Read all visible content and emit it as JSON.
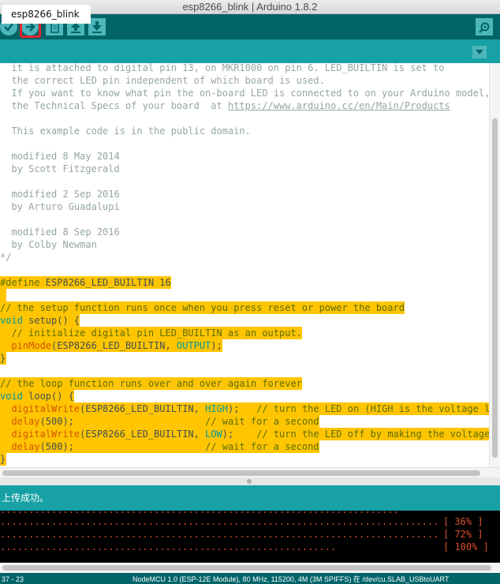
{
  "window": {
    "title": "esp8266_blink | Arduino 1.8.2"
  },
  "toolbar": {
    "buttons": [
      {
        "name": "verify",
        "icon": "check-icon"
      },
      {
        "name": "upload",
        "icon": "arrow-right-icon",
        "highlighted": true
      },
      {
        "name": "new",
        "icon": "page-icon"
      },
      {
        "name": "open",
        "icon": "arrow-up-icon"
      },
      {
        "name": "save",
        "icon": "arrow-down-icon"
      },
      {
        "name": "serial-monitor",
        "icon": "magnifier-icon"
      }
    ],
    "highlight_color": "#e4262d"
  },
  "tab": {
    "label": "esp8266_blink"
  },
  "code": {
    "lines": [
      {
        "text": "  it is attached to digital pin 13, on MKR1000 on pin 6. LED_BUILTIN is set to",
        "kind": "comment"
      },
      {
        "text": "  the correct LED pin independent of which board is used.",
        "kind": "comment"
      },
      {
        "text": "  If you want to know what pin the on-board LED is connected to on your Arduino model, che",
        "kind": "comment"
      },
      {
        "pre": "  the Technical Specs of your board  at ",
        "link": "https://www.arduino.cc/en/Main/Products",
        "kind": "comment-link"
      },
      {
        "text": "",
        "kind": "blank"
      },
      {
        "text": "  This example code is in the public domain.",
        "kind": "comment"
      },
      {
        "text": "",
        "kind": "blank"
      },
      {
        "text": "  modified 8 May 2014",
        "kind": "comment"
      },
      {
        "text": "  by Scott Fitzgerald",
        "kind": "comment"
      },
      {
        "text": "",
        "kind": "blank"
      },
      {
        "text": "  modified 2 Sep 2016",
        "kind": "comment"
      },
      {
        "text": "  by Arturo Guadalupi",
        "kind": "comment"
      },
      {
        "text": "",
        "kind": "blank"
      },
      {
        "text": "  modified 8 Sep 2016",
        "kind": "comment"
      },
      {
        "text": "  by Colby Newman",
        "kind": "comment"
      },
      {
        "text": "*/",
        "kind": "comment"
      },
      {
        "text": "",
        "kind": "blank"
      },
      {
        "directive": "#define",
        "rest": " ESP8266_LED_BUILTIN 16",
        "kind": "define"
      },
      {
        "text": "",
        "kind": "blank-hl"
      },
      {
        "text": "// the setup function runs once when you press reset or power the board",
        "kind": "comment-hl"
      },
      {
        "type": "void",
        "rest": " setup() {",
        "kind": "func-hl"
      },
      {
        "text": "  // initialize digital pin LED_BUILTIN as an output.",
        "kind": "comment-hl"
      },
      {
        "indent": "  ",
        "fn": "pinMode",
        "open": "(ESP8266_LED_BUILTIN, ",
        "arg": "OUTPUT",
        "close": ");",
        "kind": "call-hl"
      },
      {
        "text": "}",
        "kind": "code-hl"
      },
      {
        "text": "",
        "kind": "blank"
      },
      {
        "text": "// the loop function runs over and over again forever",
        "kind": "comment-hl"
      },
      {
        "type": "void",
        "rest": " loop() {",
        "kind": "func-hl"
      },
      {
        "indent": "  ",
        "fn": "digitalWrite",
        "open": "(ESP8266_LED_BUILTIN, ",
        "arg": "HIGH",
        "close": ");",
        "comment": "   // turn the LED on (HIGH is the voltage level)",
        "kind": "call-hl"
      },
      {
        "indent": "  ",
        "fn": "delay",
        "open": "(500);",
        "arg": "",
        "close": "",
        "comment": "                       // wait for a second",
        "kind": "call-hl"
      },
      {
        "indent": "  ",
        "fn": "digitalWrite",
        "open": "(ESP8266_LED_BUILTIN, ",
        "arg": "LOW",
        "close": ");",
        "comment": "    // turn the LED off by making the voltage LOW",
        "kind": "call-hl"
      },
      {
        "indent": "  ",
        "fn": "delay",
        "open": "(500);",
        "arg": "",
        "close": "",
        "comment": "                       // wait for a second",
        "kind": "call-hl"
      },
      {
        "text": "}",
        "kind": "code-hl"
      }
    ]
  },
  "status": {
    "message": "上传成功。"
  },
  "console": {
    "lines": [
      {
        "dots": ".............................................................................",
        "pct": "[ 36% ]"
      },
      {
        "dots": ".............................................................................",
        "pct": "[ 72% ]"
      },
      {
        "dots": "...........................................................",
        "pct": "[ 100% ]"
      }
    ]
  },
  "footer": {
    "line_position": "37 - 23",
    "board_info": "NodeMCU 1.0 (ESP-12E Module), 80 MHz, 115200, 4M (3M SPIFFS) 在 /dev/cu.SLAB_USBtoUART"
  },
  "colors": {
    "toolbar": "#006468",
    "tabbar": "#17a1a5",
    "button": "#4db7bb",
    "highlight_line": "#ffc501",
    "console_text": "#d8502c"
  }
}
